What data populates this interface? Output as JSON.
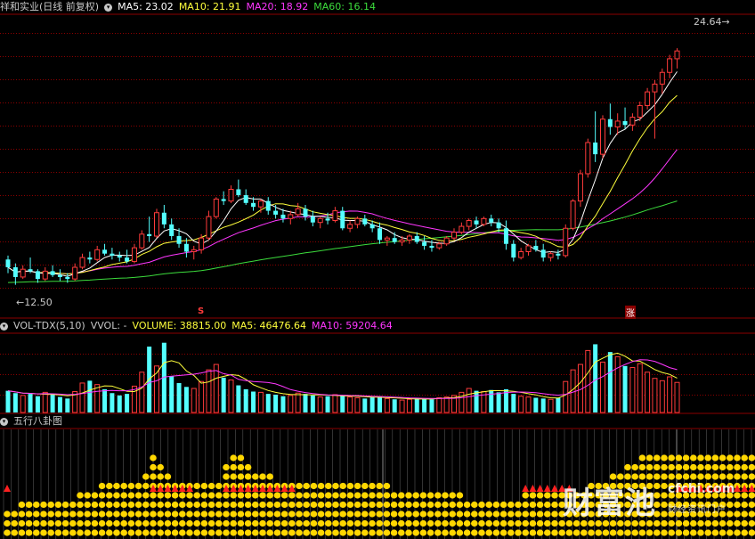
{
  "colors": {
    "up": "#ff3b3b",
    "down": "#54ffff",
    "grid": "#8b0000",
    "ma5": "#ffffff",
    "ma10": "#ffff3c",
    "ma20": "#ff37ff",
    "ma60": "#3cdc3c",
    "volma5": "#ffff3c",
    "volma10": "#ff37ff",
    "dot_yellow": "#ffd700",
    "dot_red": "#ff2020"
  },
  "header": {
    "stock": "祥和实业(日线 前复权)",
    "ma5": "MA5: 23.02",
    "ma10": "MA10: 21.91",
    "ma20": "MA20: 18.92",
    "ma60": "MA60: 16.14"
  },
  "vol_header": {
    "name": "VOL-TDX(5,10)",
    "vvol": "VVOL: -",
    "volume": "VOLUME: 38815.00",
    "ma5": "MA5: 46476.64",
    "ma10": "MA10: 59204.64"
  },
  "bagua_header": {
    "name": "五行八卦图"
  },
  "annotations": {
    "high": "24.64",
    "low": "12.50",
    "sig1": "S",
    "sig2": "涨"
  },
  "icons": {
    "collapse": "circle-chevron-icon"
  },
  "watermark": {
    "main": "财富池",
    "domain": "cfchi.com",
    "slogan": "财经资讯门户"
  },
  "chart_data": {
    "type": "candlestick",
    "price_range": [
      11.8,
      26.2
    ],
    "vol_range": [
      0,
      100000
    ],
    "candles": [
      [
        13.8,
        14.0,
        13.1,
        13.4
      ],
      [
        13.4,
        13.6,
        12.5,
        12.9
      ],
      [
        12.9,
        13.5,
        12.8,
        13.3
      ],
      [
        13.3,
        13.9,
        13.1,
        13.2
      ],
      [
        13.2,
        13.3,
        12.6,
        12.8
      ],
      [
        12.8,
        13.4,
        12.7,
        13.2
      ],
      [
        13.2,
        13.5,
        12.9,
        13.0
      ],
      [
        13.0,
        13.3,
        12.7,
        12.9
      ],
      [
        12.9,
        13.1,
        12.6,
        12.8
      ],
      [
        12.8,
        13.6,
        12.7,
        13.4
      ],
      [
        13.4,
        14.1,
        13.3,
        13.9
      ],
      [
        13.9,
        14.2,
        13.6,
        13.8
      ],
      [
        13.8,
        14.5,
        13.7,
        14.3
      ],
      [
        14.3,
        14.6,
        14.0,
        14.1
      ],
      [
        14.1,
        14.4,
        13.8,
        14.0
      ],
      [
        14.0,
        14.2,
        13.7,
        13.9
      ],
      [
        13.9,
        14.3,
        13.6,
        13.7
      ],
      [
        13.7,
        14.6,
        13.6,
        14.4
      ],
      [
        14.4,
        15.3,
        14.3,
        15.1
      ],
      [
        15.1,
        16.0,
        14.7,
        15.0
      ],
      [
        15.0,
        16.4,
        14.9,
        16.2
      ],
      [
        16.2,
        16.6,
        15.4,
        15.6
      ],
      [
        15.6,
        15.9,
        14.8,
        15.0
      ],
      [
        15.0,
        15.4,
        14.4,
        14.6
      ],
      [
        14.6,
        14.9,
        13.9,
        14.2
      ],
      [
        14.2,
        14.5,
        13.8,
        14.3
      ],
      [
        14.3,
        15.1,
        14.1,
        14.9
      ],
      [
        14.9,
        16.3,
        14.8,
        16.0
      ],
      [
        16.0,
        17.0,
        15.9,
        16.9
      ],
      [
        16.9,
        17.3,
        16.6,
        16.8
      ],
      [
        16.8,
        17.6,
        16.7,
        17.4
      ],
      [
        17.4,
        17.9,
        17.0,
        17.1
      ],
      [
        17.1,
        17.4,
        16.6,
        16.7
      ],
      [
        16.7,
        17.0,
        16.3,
        16.5
      ],
      [
        16.5,
        16.9,
        16.2,
        16.8
      ],
      [
        16.8,
        17.0,
        16.1,
        16.3
      ],
      [
        16.3,
        16.6,
        15.9,
        16.1
      ],
      [
        16.1,
        16.4,
        15.7,
        15.9
      ],
      [
        15.9,
        16.3,
        15.6,
        16.1
      ],
      [
        16.1,
        16.7,
        16.0,
        16.4
      ],
      [
        16.4,
        16.6,
        15.8,
        16.0
      ],
      [
        16.0,
        16.3,
        15.5,
        15.7
      ],
      [
        15.7,
        16.0,
        15.4,
        15.9
      ],
      [
        15.9,
        16.2,
        15.6,
        15.8
      ],
      [
        15.8,
        16.5,
        15.7,
        16.3
      ],
      [
        16.3,
        16.5,
        15.3,
        15.4
      ],
      [
        15.4,
        15.8,
        15.2,
        15.6
      ],
      [
        15.6,
        16.0,
        15.4,
        15.9
      ],
      [
        15.9,
        16.1,
        15.5,
        15.6
      ],
      [
        15.6,
        15.8,
        15.2,
        15.4
      ],
      [
        15.4,
        15.7,
        14.6,
        14.8
      ],
      [
        14.8,
        15.0,
        14.5,
        14.9
      ],
      [
        14.9,
        15.2,
        14.6,
        14.7
      ],
      [
        14.7,
        15.0,
        14.5,
        14.8
      ],
      [
        14.8,
        15.1,
        14.6,
        15.0
      ],
      [
        15.0,
        15.2,
        14.6,
        14.7
      ],
      [
        14.7,
        15.0,
        14.3,
        14.5
      ],
      [
        14.5,
        14.8,
        14.2,
        14.4
      ],
      [
        14.4,
        14.7,
        14.3,
        14.6
      ],
      [
        14.6,
        15.0,
        14.5,
        14.9
      ],
      [
        14.9,
        15.4,
        14.8,
        15.2
      ],
      [
        15.2,
        15.7,
        15.1,
        15.5
      ],
      [
        15.5,
        15.9,
        15.3,
        15.8
      ],
      [
        15.8,
        16.0,
        15.4,
        15.6
      ],
      [
        15.6,
        16.0,
        15.5,
        15.9
      ],
      [
        15.9,
        16.1,
        15.5,
        15.7
      ],
      [
        15.7,
        15.9,
        15.2,
        15.4
      ],
      [
        15.4,
        15.8,
        14.3,
        14.6
      ],
      [
        14.6,
        14.8,
        13.7,
        13.9
      ],
      [
        13.9,
        14.4,
        13.8,
        14.2
      ],
      [
        14.2,
        14.6,
        14.0,
        14.5
      ],
      [
        14.5,
        14.8,
        14.2,
        14.3
      ],
      [
        14.3,
        14.6,
        13.7,
        13.9
      ],
      [
        13.9,
        14.2,
        13.7,
        14.1
      ],
      [
        14.1,
        14.3,
        13.8,
        14.0
      ],
      [
        14.0,
        15.6,
        13.9,
        15.4
      ],
      [
        15.4,
        16.9,
        15.3,
        16.8
      ],
      [
        16.8,
        18.4,
        16.5,
        18.2
      ],
      [
        18.2,
        20.0,
        18.0,
        19.8
      ],
      [
        19.8,
        21.4,
        18.8,
        19.2
      ],
      [
        19.2,
        21.2,
        19.0,
        21.0
      ],
      [
        21.0,
        21.8,
        20.2,
        20.6
      ],
      [
        20.6,
        21.3,
        20.2,
        20.9
      ],
      [
        20.9,
        21.6,
        20.5,
        20.7
      ],
      [
        20.7,
        21.3,
        20.4,
        21.1
      ],
      [
        21.1,
        21.9,
        20.9,
        21.7
      ],
      [
        21.7,
        22.6,
        21.5,
        22.4
      ],
      [
        22.4,
        23.0,
        20.0,
        22.8
      ],
      [
        22.8,
        23.6,
        22.3,
        23.4
      ],
      [
        23.4,
        24.3,
        23.1,
        24.1
      ],
      [
        24.1,
        24.64,
        23.6,
        24.5
      ]
    ],
    "volume": [
      28000,
      25000,
      22000,
      24000,
      21000,
      26000,
      23000,
      20000,
      18000,
      27000,
      38000,
      41000,
      36000,
      30000,
      25000,
      22000,
      24000,
      34000,
      52000,
      85000,
      60000,
      90000,
      47000,
      38000,
      33000,
      31000,
      40000,
      55000,
      62000,
      45000,
      42000,
      35000,
      30000,
      27000,
      26000,
      24000,
      23000,
      21000,
      22000,
      25000,
      24000,
      22000,
      20000,
      21000,
      23000,
      22000,
      20000,
      19000,
      18000,
      20000,
      21000,
      18000,
      17000,
      16000,
      17000,
      19000,
      18000,
      17000,
      19000,
      20000,
      22000,
      26000,
      31000,
      28000,
      27000,
      29000,
      26000,
      30000,
      24000,
      21000,
      20000,
      19000,
      18000,
      17000,
      19000,
      40000,
      55000,
      62000,
      80000,
      88000,
      65000,
      78000,
      72000,
      60000,
      58000,
      63000,
      52000,
      44000,
      41000,
      46000,
      38815
    ],
    "bagua": [
      3,
      3,
      4,
      4,
      4,
      4,
      4,
      4,
      4,
      4,
      5,
      5,
      5,
      6,
      6,
      6,
      6,
      6,
      6,
      7,
      9,
      8,
      7,
      6,
      6,
      6,
      6,
      6,
      6,
      6,
      8,
      9,
      9,
      8,
      7,
      7,
      7,
      6,
      6,
      6,
      6,
      6,
      6,
      6,
      6,
      6,
      6,
      6,
      6,
      6,
      6,
      6,
      6,
      5,
      5,
      5,
      5,
      5,
      5,
      5,
      5,
      5,
      5,
      4,
      4,
      4,
      4,
      4,
      4,
      4,
      4,
      5,
      5,
      5,
      5,
      5,
      5,
      5,
      5,
      5,
      6,
      6,
      6,
      7,
      7,
      8,
      8,
      9,
      9,
      9,
      9,
      9,
      9,
      9,
      9,
      9,
      9,
      9,
      9,
      9,
      9,
      9,
      9,
      9
    ]
  }
}
